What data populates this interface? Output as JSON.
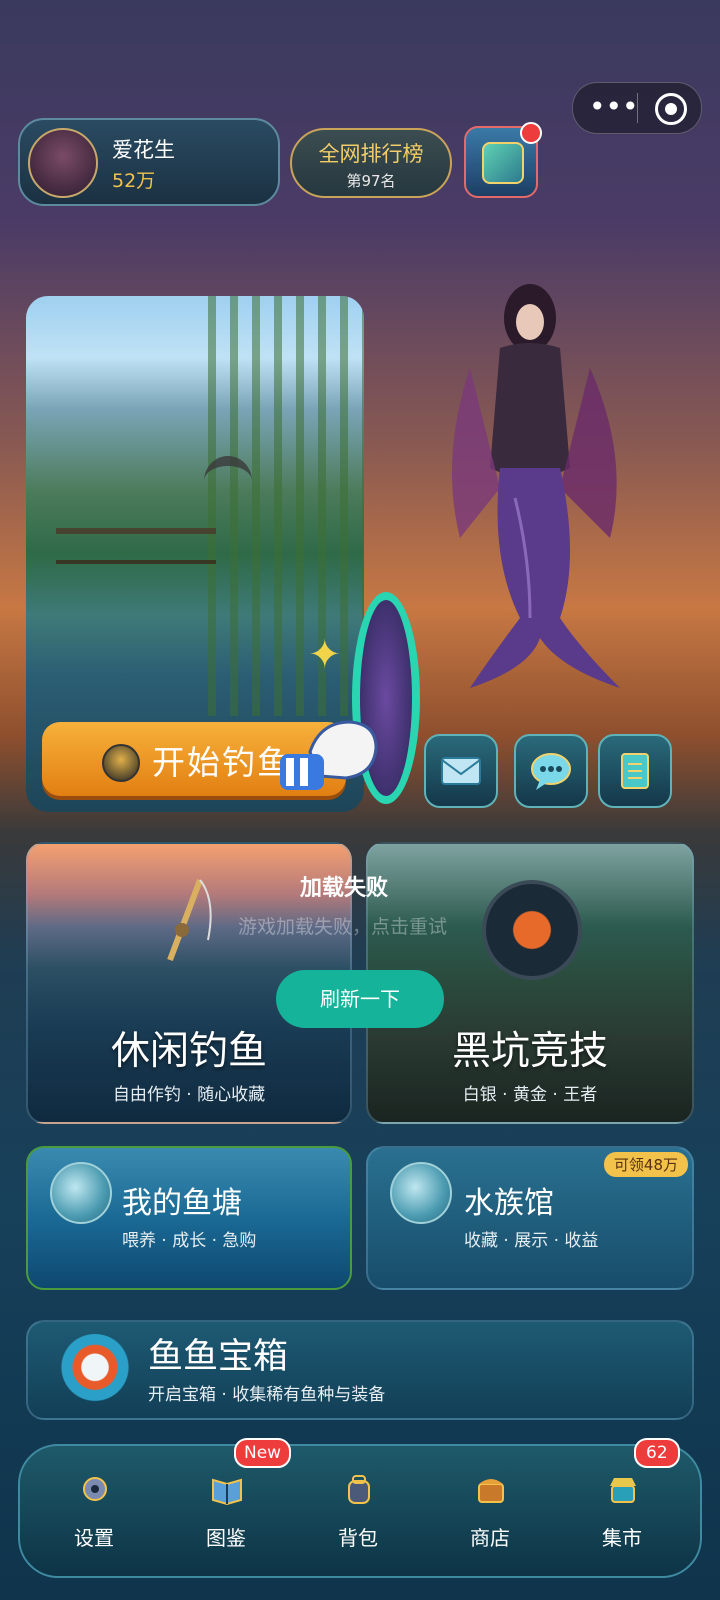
{
  "topbar": {
    "more_glyph": "•••"
  },
  "user": {
    "name": "爱花生",
    "coins": "52万"
  },
  "rank": {
    "title": "全网排行榜",
    "position": "第97名"
  },
  "main": {
    "start_fishing": "开始钓鱼"
  },
  "error": {
    "title": "加载失败",
    "message": "游戏加载失败，点击重试",
    "refresh": "刷新一下"
  },
  "modes": {
    "casual": {
      "title": "休闲钓鱼",
      "subtitle": "自由作钓 · 随心收藏"
    },
    "pit": {
      "title": "黑坑竞技",
      "subtitle": "白银 · 黄金 · 王者"
    },
    "pond": {
      "title": "我的鱼塘",
      "subtitle": "喂养 · 成长 · 急购"
    },
    "aquarium": {
      "title": "水族馆",
      "subtitle": "收藏 · 展示 · 收益",
      "badge": "可领48万"
    },
    "chest": {
      "title": "鱼鱼宝箱",
      "subtitle": "开启宝箱 · 收集稀有鱼种与装备"
    }
  },
  "nav": [
    {
      "label": "设置",
      "icon": "gear-icon"
    },
    {
      "label": "图鉴",
      "icon": "book-icon",
      "badge": "New"
    },
    {
      "label": "背包",
      "icon": "backpack-icon"
    },
    {
      "label": "商店",
      "icon": "shop-icon"
    },
    {
      "label": "集市",
      "icon": "market-icon",
      "badge": "62"
    }
  ],
  "colors": {
    "accent_teal": "#16b39b",
    "orange_button": "#f7b13a",
    "gold": "#f2c24a",
    "badge_red": "#ee3b3b"
  }
}
